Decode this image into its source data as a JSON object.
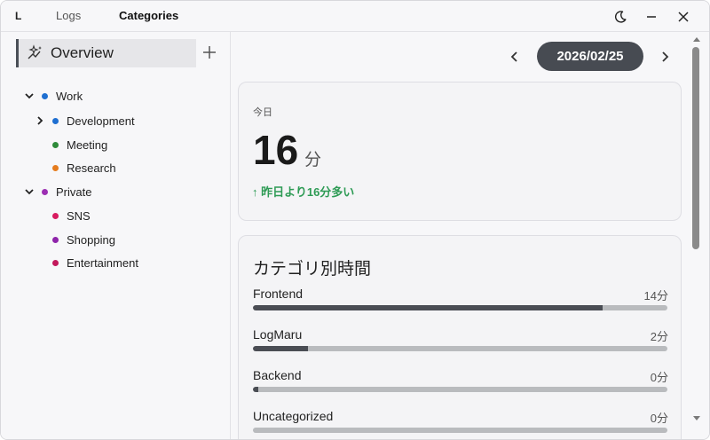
{
  "app": {
    "logo": "L"
  },
  "tabs": [
    {
      "label": "Logs",
      "active": false
    },
    {
      "label": "Categories",
      "active": true
    }
  ],
  "window_controls": [
    "theme-moon-icon",
    "minimize-icon",
    "close-icon"
  ],
  "sidebar": {
    "overview_label": "Overview",
    "tree": [
      {
        "label": "Work",
        "color": "#1f6fd1",
        "expanded": true,
        "level": 0
      },
      {
        "label": "Development",
        "color": "#1f6fd1",
        "expanded": false,
        "has_children": true,
        "level": 1
      },
      {
        "label": "Meeting",
        "color": "#2e8b3a",
        "level": 1
      },
      {
        "label": "Research",
        "color": "#e57c1e",
        "level": 1
      },
      {
        "label": "Private",
        "color": "#9c2fb3",
        "expanded": true,
        "level": 0
      },
      {
        "label": "SNS",
        "color": "#d81b60",
        "level": 1
      },
      {
        "label": "Shopping",
        "color": "#8e24aa",
        "level": 1
      },
      {
        "label": "Entertainment",
        "color": "#c2185b",
        "level": 1
      }
    ]
  },
  "main": {
    "date": "2026/02/25",
    "today": {
      "label": "今日",
      "minutes": "16",
      "unit": "分",
      "diff": "↑ 昨日より16分多い"
    },
    "categories": {
      "title": "カテゴリ別時間",
      "items": [
        {
          "name": "Frontend",
          "value": "14分",
          "fraction": 0.844
        },
        {
          "name": "LogMaru",
          "value": "2分",
          "fraction": 0.132
        },
        {
          "name": "Backend",
          "value": "0分",
          "fraction": 0.013
        },
        {
          "name": "Uncategorized",
          "value": "0分",
          "fraction": 0.0
        }
      ]
    }
  },
  "colors": {
    "accent": "#474b52",
    "positive": "#2e9b55",
    "track": "#b9bbbe"
  }
}
